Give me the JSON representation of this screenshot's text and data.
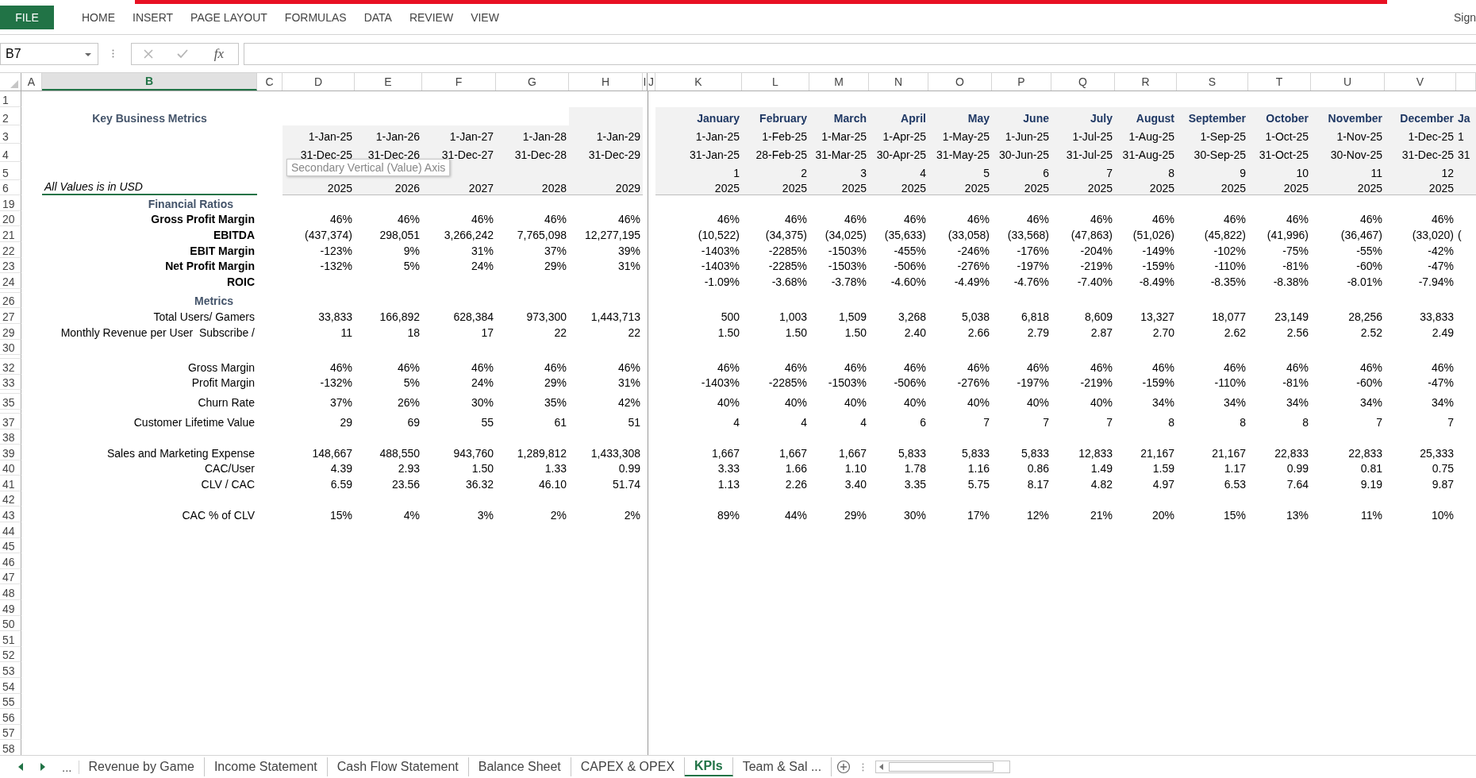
{
  "ribbon": {
    "file_tab": "FILE",
    "tabs": [
      "HOME",
      "INSERT",
      "PAGE LAYOUT",
      "FORMULAS",
      "DATA",
      "REVIEW",
      "VIEW"
    ],
    "account": "Sign"
  },
  "formula_bar": {
    "name_box": "B7",
    "function_label": "fx"
  },
  "columns": [
    {
      "letter": "A",
      "selected": false
    },
    {
      "letter": "B",
      "selected": true
    },
    {
      "letter": "C",
      "selected": false
    },
    {
      "letter": "D",
      "selected": false
    },
    {
      "letter": "E",
      "selected": false
    },
    {
      "letter": "F",
      "selected": false
    },
    {
      "letter": "G",
      "selected": false
    },
    {
      "letter": "H",
      "selected": false
    },
    {
      "letter": "I",
      "selected": false
    },
    {
      "letter": "J",
      "selected": false
    },
    {
      "letter": "K",
      "selected": false
    },
    {
      "letter": "L",
      "selected": false
    },
    {
      "letter": "M",
      "selected": false
    },
    {
      "letter": "N",
      "selected": false
    },
    {
      "letter": "O",
      "selected": false
    },
    {
      "letter": "P",
      "selected": false
    },
    {
      "letter": "Q",
      "selected": false
    },
    {
      "letter": "R",
      "selected": false
    },
    {
      "letter": "S",
      "selected": false
    },
    {
      "letter": "T",
      "selected": false
    },
    {
      "letter": "U",
      "selected": false
    },
    {
      "letter": "V",
      "selected": false
    }
  ],
  "header": {
    "title": "Key Business Metrics",
    "note": "All Values is in USD",
    "row_numbers": [
      "1",
      "2",
      "3",
      "4",
      "5",
      "6"
    ],
    "annual": [
      {
        "start": "1-Jan-25",
        "end": "31-Dec-25",
        "year": "2025"
      },
      {
        "start": "1-Jan-26",
        "end": "31-Dec-26",
        "year": "2026"
      },
      {
        "start": "1-Jan-27",
        "end": "31-Dec-27",
        "year": "2027"
      },
      {
        "start": "1-Jan-28",
        "end": "31-Dec-28",
        "year": "2028"
      },
      {
        "start": "1-Jan-29",
        "end": "31-Dec-29",
        "year": "2029"
      }
    ],
    "monthly": [
      {
        "name": "January",
        "start": "1-Jan-25",
        "end": "31-Jan-25",
        "period": "1",
        "year": "2025"
      },
      {
        "name": "February",
        "start": "1-Feb-25",
        "end": "28-Feb-25",
        "period": "2",
        "year": "2025"
      },
      {
        "name": "March",
        "start": "1-Mar-25",
        "end": "31-Mar-25",
        "period": "3",
        "year": "2025"
      },
      {
        "name": "April",
        "start": "1-Apr-25",
        "end": "30-Apr-25",
        "period": "4",
        "year": "2025"
      },
      {
        "name": "May",
        "start": "1-May-25",
        "end": "31-May-25",
        "period": "5",
        "year": "2025"
      },
      {
        "name": "June",
        "start": "1-Jun-25",
        "end": "30-Jun-25",
        "period": "6",
        "year": "2025"
      },
      {
        "name": "July",
        "start": "1-Jul-25",
        "end": "31-Jul-25",
        "period": "7",
        "year": "2025"
      },
      {
        "name": "August",
        "start": "1-Aug-25",
        "end": "31-Aug-25",
        "period": "8",
        "year": "2025"
      },
      {
        "name": "September",
        "start": "1-Sep-25",
        "end": "30-Sep-25",
        "period": "9",
        "year": "2025"
      },
      {
        "name": "October",
        "start": "1-Oct-25",
        "end": "31-Oct-25",
        "period": "10",
        "year": "2025"
      },
      {
        "name": "November",
        "start": "1-Nov-25",
        "end": "30-Nov-25",
        "period": "11",
        "year": "2025"
      },
      {
        "name": "December",
        "start": "1-Dec-25",
        "end": "31-Dec-25",
        "period": "12",
        "year": "2025"
      }
    ],
    "cut_month": {
      "name": "Ja",
      "start": "1",
      "end": "31"
    }
  },
  "tooltip": "Secondary Vertical (Value) Axis",
  "rows": [
    {
      "num": "19",
      "kind": "section",
      "label": "Financial Ratios"
    },
    {
      "num": "20",
      "kind": "bold",
      "label": "Gross Profit Margin",
      "annual": [
        "46%",
        "46%",
        "46%",
        "46%",
        "46%"
      ],
      "monthly": [
        "46%",
        "46%",
        "46%",
        "46%",
        "46%",
        "46%",
        "46%",
        "46%",
        "46%",
        "46%",
        "46%",
        "46%"
      ]
    },
    {
      "num": "21",
      "kind": "bold",
      "label": "EBITDA",
      "annual": [
        "(437,374)",
        "298,051",
        "3,266,242",
        "7,765,098",
        "12,277,195"
      ],
      "monthly": [
        "(10,522)",
        "(34,375)",
        "(34,025)",
        "(35,633)",
        "(33,058)",
        "(33,568)",
        "(47,863)",
        "(51,026)",
        "(45,822)",
        "(41,996)",
        "(36,467)",
        "(33,020)"
      ],
      "cut": "("
    },
    {
      "num": "22",
      "kind": "bold",
      "label": "EBIT Margin",
      "annual": [
        "-123%",
        "9%",
        "31%",
        "37%",
        "39%"
      ],
      "monthly": [
        "-1403%",
        "-2285%",
        "-1503%",
        "-455%",
        "-246%",
        "-176%",
        "-204%",
        "-149%",
        "-102%",
        "-75%",
        "-55%",
        "-42%"
      ]
    },
    {
      "num": "23",
      "kind": "bold",
      "label": "Net Profit Margin",
      "annual": [
        "-132%",
        "5%",
        "24%",
        "29%",
        "31%"
      ],
      "monthly": [
        "-1403%",
        "-2285%",
        "-1503%",
        "-506%",
        "-276%",
        "-197%",
        "-219%",
        "-159%",
        "-110%",
        "-81%",
        "-60%",
        "-47%"
      ]
    },
    {
      "num": "24",
      "kind": "bold",
      "label": "ROIC",
      "monthly": [
        "-1.09%",
        "-3.68%",
        "-3.78%",
        "-4.60%",
        "-4.49%",
        "-4.76%",
        "-7.40%",
        "-8.49%",
        "-8.35%",
        "-8.38%",
        "-8.01%",
        "-7.94%"
      ]
    },
    {
      "kind": "collapsed"
    },
    {
      "num": "26",
      "kind": "section",
      "label": "Metrics"
    },
    {
      "num": "27",
      "kind": "plain",
      "label": "Total Users/ Gamers",
      "annual": [
        "33,833",
        "166,892",
        "628,384",
        "973,300",
        "1,443,713"
      ],
      "monthly": [
        "500",
        "1,003",
        "1,509",
        "3,268",
        "5,038",
        "6,818",
        "8,609",
        "13,327",
        "18,077",
        "23,149",
        "28,256",
        "33,833"
      ]
    },
    {
      "num": "29",
      "kind": "plain",
      "label": "Monthly Revenue per User  Subscribe /",
      "annual": [
        "11",
        "18",
        "17",
        "22",
        "22"
      ],
      "monthly": [
        "1.50",
        "1.50",
        "1.50",
        "2.40",
        "2.66",
        "2.79",
        "2.87",
        "2.70",
        "2.62",
        "2.56",
        "2.52",
        "2.49"
      ]
    },
    {
      "num": "30",
      "kind": "blank"
    },
    {
      "kind": "collapsed"
    },
    {
      "num": "32",
      "kind": "plain",
      "label": "Gross Margin",
      "annual": [
        "46%",
        "46%",
        "46%",
        "46%",
        "46%"
      ],
      "monthly": [
        "46%",
        "46%",
        "46%",
        "46%",
        "46%",
        "46%",
        "46%",
        "46%",
        "46%",
        "46%",
        "46%",
        "46%"
      ]
    },
    {
      "num": "33",
      "kind": "plain",
      "label": "Profit Margin",
      "annual": [
        "-132%",
        "5%",
        "24%",
        "29%",
        "31%"
      ],
      "monthly": [
        "-1403%",
        "-2285%",
        "-1503%",
        "-506%",
        "-276%",
        "-197%",
        "-219%",
        "-159%",
        "-110%",
        "-81%",
        "-60%",
        "-47%"
      ]
    },
    {
      "kind": "collapsed"
    },
    {
      "num": "35",
      "kind": "plain",
      "label": "Churn Rate",
      "annual": [
        "37%",
        "26%",
        "30%",
        "35%",
        "42%"
      ],
      "monthly": [
        "40%",
        "40%",
        "40%",
        "40%",
        "40%",
        "40%",
        "40%",
        "34%",
        "34%",
        "34%",
        "34%",
        "34%"
      ]
    },
    {
      "kind": "collapsed"
    },
    {
      "num": "37",
      "kind": "plain",
      "label": "Customer Lifetime Value",
      "annual": [
        "29",
        "69",
        "55",
        "61",
        "51"
      ],
      "monthly": [
        "4",
        "4",
        "4",
        "6",
        "7",
        "7",
        "7",
        "8",
        "8",
        "8",
        "7",
        "7"
      ]
    },
    {
      "num": "38",
      "kind": "blank"
    },
    {
      "num": "39",
      "kind": "plain",
      "label": "Sales and Marketing Expense",
      "annual": [
        "148,667",
        "488,550",
        "943,760",
        "1,289,812",
        "1,433,308"
      ],
      "monthly": [
        "1,667",
        "1,667",
        "1,667",
        "5,833",
        "5,833",
        "5,833",
        "12,833",
        "21,167",
        "21,167",
        "22,833",
        "22,833",
        "25,333"
      ]
    },
    {
      "num": "40",
      "kind": "plain",
      "label": "CAC/User",
      "annual": [
        "4.39",
        "2.93",
        "1.50",
        "1.33",
        "0.99"
      ],
      "monthly": [
        "3.33",
        "1.66",
        "1.10",
        "1.78",
        "1.16",
        "0.86",
        "1.49",
        "1.59",
        "1.17",
        "0.99",
        "0.81",
        "0.75"
      ]
    },
    {
      "num": "41",
      "kind": "plain",
      "label": "CLV / CAC",
      "annual": [
        "6.59",
        "23.56",
        "36.32",
        "46.10",
        "51.74"
      ],
      "monthly": [
        "1.13",
        "2.26",
        "3.40",
        "3.35",
        "5.75",
        "8.17",
        "4.82",
        "4.97",
        "6.53",
        "7.64",
        "9.19",
        "9.87"
      ]
    },
    {
      "num": "42",
      "kind": "blank"
    },
    {
      "num": "43",
      "kind": "plain",
      "label": "CAC % of CLV",
      "annual": [
        "15%",
        "4%",
        "3%",
        "2%",
        "2%"
      ],
      "monthly": [
        "89%",
        "44%",
        "29%",
        "30%",
        "17%",
        "12%",
        "21%",
        "20%",
        "15%",
        "13%",
        "11%",
        "10%"
      ]
    },
    {
      "num": "44",
      "kind": "blank"
    },
    {
      "num": "45",
      "kind": "blank"
    },
    {
      "num": "46",
      "kind": "blank"
    },
    {
      "num": "47",
      "kind": "blank"
    },
    {
      "num": "48",
      "kind": "blank"
    },
    {
      "num": "49",
      "kind": "blank"
    },
    {
      "num": "50",
      "kind": "blank"
    },
    {
      "num": "51",
      "kind": "blank"
    },
    {
      "num": "52",
      "kind": "blank"
    },
    {
      "num": "53",
      "kind": "blank"
    },
    {
      "num": "54",
      "kind": "blank"
    },
    {
      "num": "55",
      "kind": "blank"
    },
    {
      "num": "56",
      "kind": "blank"
    },
    {
      "num": "57",
      "kind": "blank"
    },
    {
      "num": "58",
      "kind": "blank"
    }
  ],
  "sheet_nav": {
    "overflow": "..."
  },
  "sheet_tabs": [
    {
      "label": "Revenue by Game",
      "selected": false
    },
    {
      "label": "Income Statement",
      "selected": false
    },
    {
      "label": "Cash Flow Statement",
      "selected": false
    },
    {
      "label": "Balance Sheet",
      "selected": false
    },
    {
      "label": "CAPEX & OPEX",
      "selected": false
    },
    {
      "label": "KPIs",
      "selected": true
    },
    {
      "label": "Team & Sal ...",
      "selected": false
    }
  ]
}
